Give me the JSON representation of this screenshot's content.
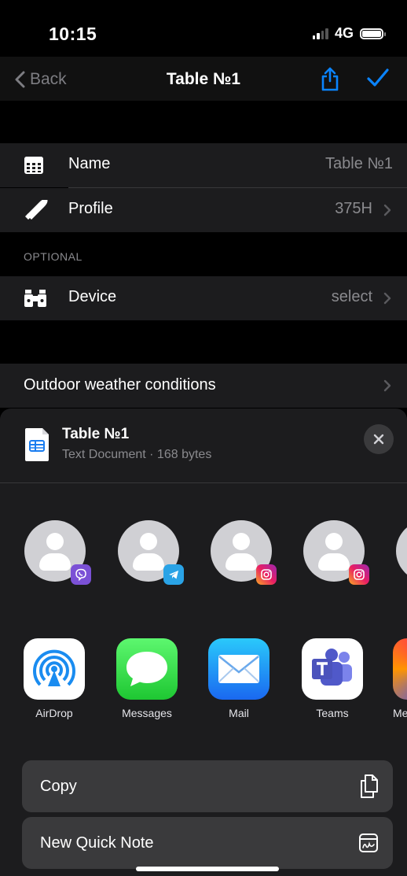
{
  "status": {
    "time": "10:15",
    "network": "4G"
  },
  "nav": {
    "back_label": "Back",
    "title": "Table №1"
  },
  "form": {
    "name_label": "Name",
    "name_value": "Table №1",
    "profile_label": "Profile",
    "profile_value": "375H",
    "optional_header": "OPTIONAL",
    "device_label": "Device",
    "device_value": "select",
    "weather_label": "Outdoor weather conditions"
  },
  "share_sheet": {
    "doc_title": "Table №1",
    "doc_subtitle": "Text Document · 168 bytes",
    "contacts": [
      {
        "badge": "viber-icon"
      },
      {
        "badge": "telegram-icon"
      },
      {
        "badge": "instagram-icon"
      },
      {
        "badge": "instagram-icon"
      }
    ],
    "apps": [
      {
        "name": "AirDrop"
      },
      {
        "name": "Messages"
      },
      {
        "name": "Mail"
      },
      {
        "name": "Teams"
      },
      {
        "name": "Me"
      }
    ],
    "actions": [
      {
        "label": "Copy",
        "icon": "copy-icon"
      },
      {
        "label": "New Quick Note",
        "icon": "quick-note-icon"
      }
    ]
  },
  "colors": {
    "accent": "#0a84ff",
    "background": "#000000",
    "cell": "#1c1c1e",
    "secondary_text": "#8a8a8e"
  }
}
